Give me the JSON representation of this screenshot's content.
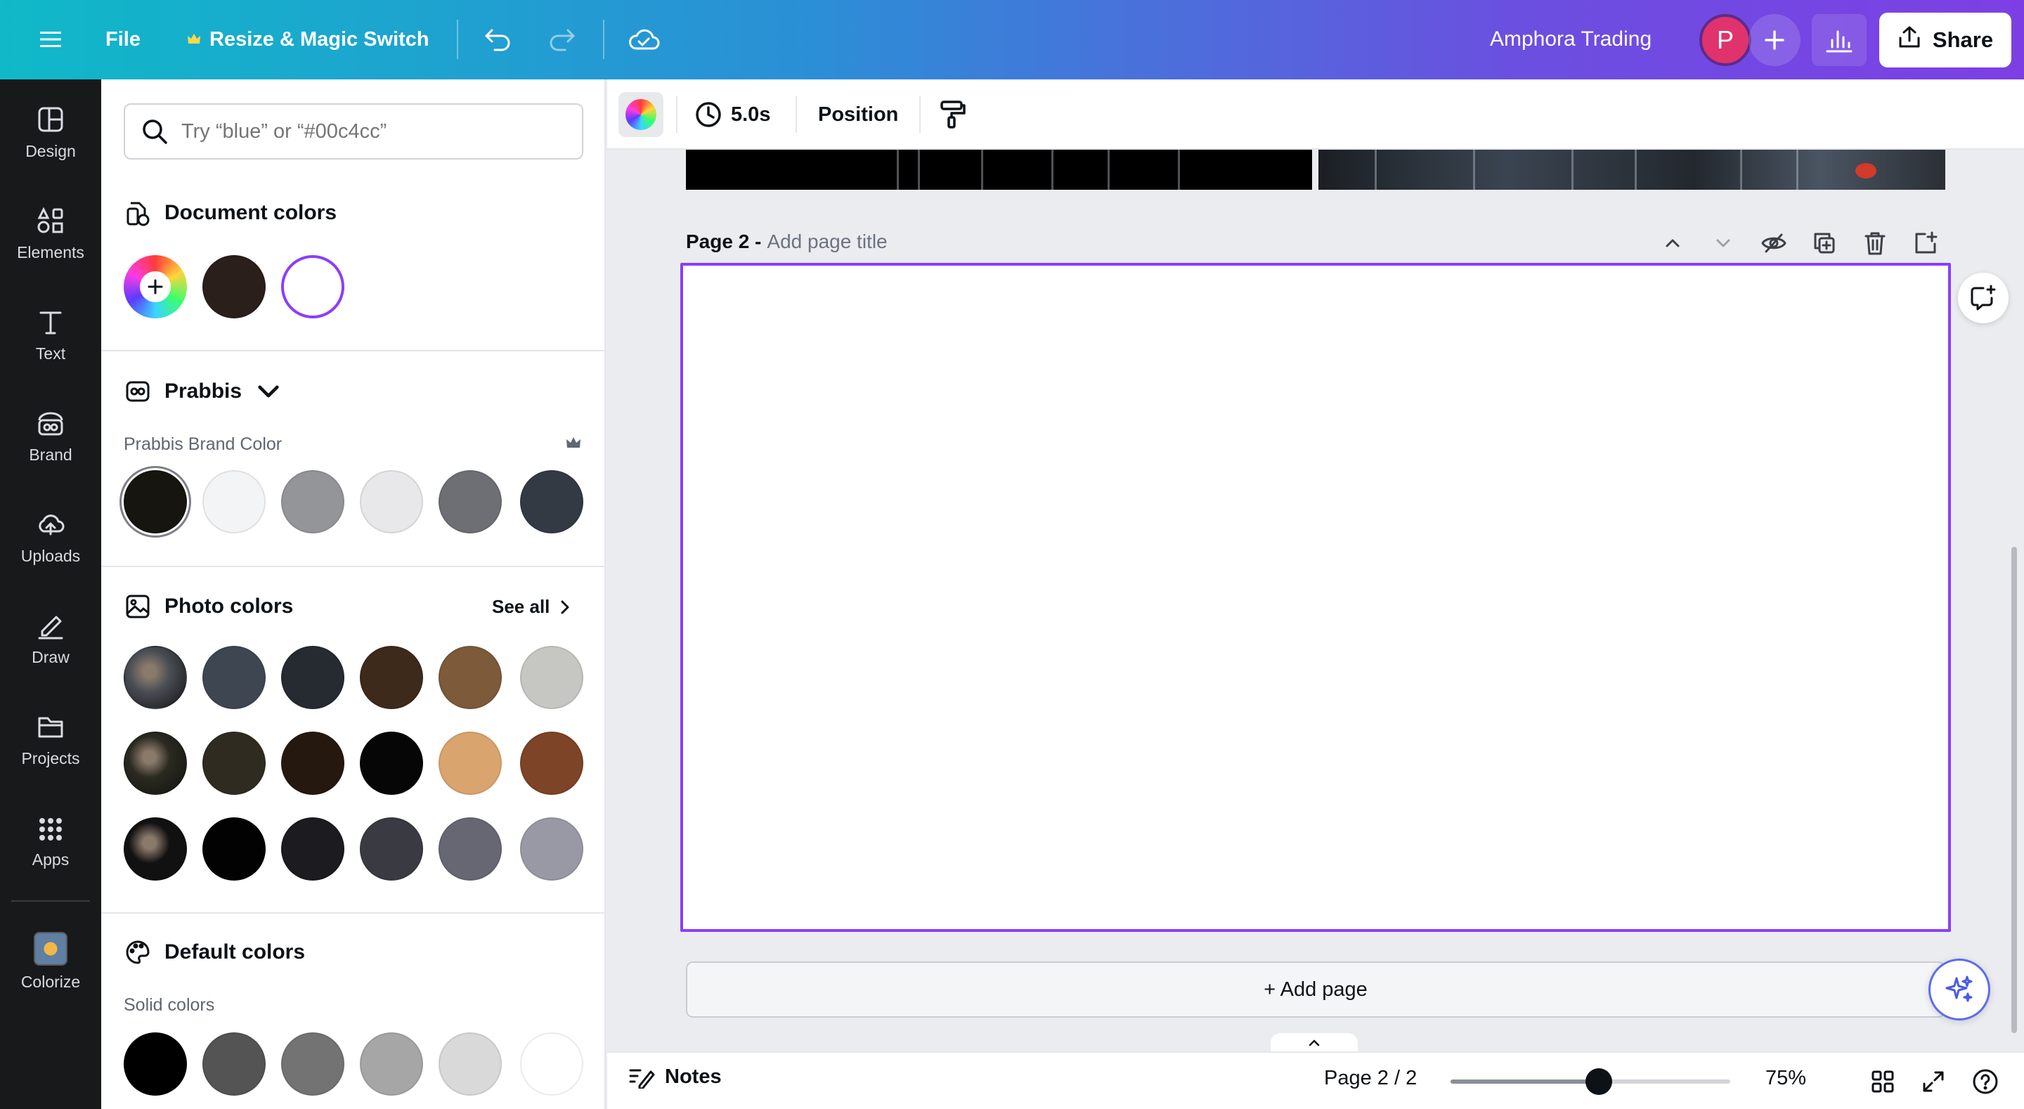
{
  "topbar": {
    "file_label": "File",
    "resize_label": "Resize & Magic Switch",
    "project_title": "Amphora Trading",
    "avatar_initial": "P",
    "share_label": "Share"
  },
  "rail": {
    "items": [
      {
        "label": "Design",
        "icon": "layout-icon"
      },
      {
        "label": "Elements",
        "icon": "shapes-icon"
      },
      {
        "label": "Text",
        "icon": "text-icon"
      },
      {
        "label": "Brand",
        "icon": "brand-icon"
      },
      {
        "label": "Uploads",
        "icon": "cloud-upload-icon"
      },
      {
        "label": "Draw",
        "icon": "pen-icon"
      },
      {
        "label": "Projects",
        "icon": "folder-icon"
      },
      {
        "label": "Apps",
        "icon": "apps-grid-icon"
      },
      {
        "label": "Colorize",
        "icon": "colorize-app-icon"
      }
    ]
  },
  "panel": {
    "search_placeholder": "Try “blue” or “#00c4cc”",
    "document_colors": {
      "title": "Document colors",
      "swatches": [
        "#2b1f1c",
        "#ffffff"
      ]
    },
    "brand": {
      "title": "Prabbis",
      "subtitle": "Prabbis Brand Color",
      "swatches": [
        "#16150f",
        "#f3f4f6",
        "#939598",
        "#e8e8ea",
        "#6d6f74",
        "#343a44"
      ]
    },
    "photo_colors": {
      "title": "Photo colors",
      "see_all": "See all",
      "rows": [
        [
          "#4a4e55",
          "#3e4651",
          "#262a31",
          "#3e2a1b",
          "#7c5a3a",
          "#c6c7c3"
        ],
        [
          "#2b2a20",
          "#302b20",
          "#25190f",
          "#060606",
          "#d9a46e",
          "#7d4427"
        ],
        [
          "#111111",
          "#020202",
          "#1c1c20",
          "#3a3b42",
          "#666773",
          "#9999a5"
        ]
      ]
    },
    "default_colors": {
      "title": "Default colors",
      "subtitle": "Solid colors",
      "swatches": [
        "#000000",
        "#545454",
        "#737373",
        "#a6a6a6",
        "#d9d9d9",
        "#ffffff"
      ]
    }
  },
  "context_bar": {
    "duration": "5.0s",
    "position_label": "Position"
  },
  "canvas": {
    "page_number_label": "Page 2 -",
    "page_title_placeholder": "Add page title",
    "add_page_label": "+ Add page"
  },
  "bottombar": {
    "notes_label": "Notes",
    "page_count": "Page 2 / 2",
    "zoom_percent": "75%",
    "zoom_fraction": 0.53
  },
  "colors": {
    "accent_purple": "#8b3dff",
    "avatar_pink": "#e0336e"
  }
}
